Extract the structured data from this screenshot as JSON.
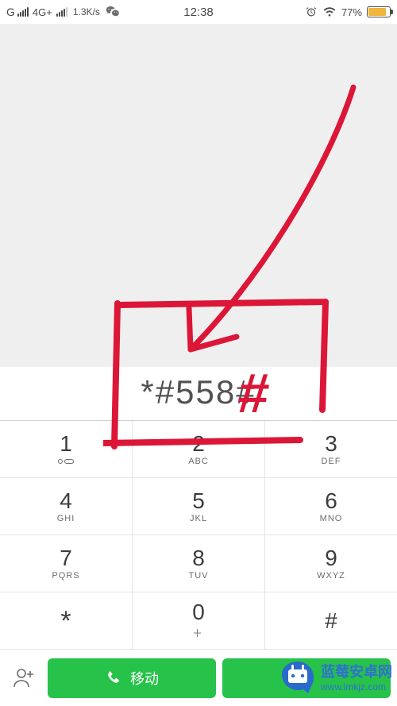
{
  "status": {
    "carrier_indicator": "G",
    "network": "4G+",
    "speed": "1.3K/s",
    "time": "12:38",
    "battery_pct": "77%",
    "wechat_icon": "wechat",
    "alarm_icon": "alarm",
    "wifi_icon": "wifi"
  },
  "dialer": {
    "display": "*#558#",
    "keys": [
      [
        {
          "d": "1",
          "l": "voicemail"
        },
        {
          "d": "2",
          "l": "ABC"
        },
        {
          "d": "3",
          "l": "DEF"
        }
      ],
      [
        {
          "d": "4",
          "l": "GHI"
        },
        {
          "d": "5",
          "l": "JKL"
        },
        {
          "d": "6",
          "l": "MNO"
        }
      ],
      [
        {
          "d": "7",
          "l": "PQRS"
        },
        {
          "d": "8",
          "l": "TUV"
        },
        {
          "d": "9",
          "l": "WXYZ"
        }
      ],
      [
        {
          "d": "*",
          "l": ""
        },
        {
          "d": "0",
          "l": "＋"
        },
        {
          "d": "#",
          "l": ""
        }
      ]
    ],
    "actions": {
      "add_contact_icon": "add-contact",
      "call1_label": "移动",
      "call2_label": ""
    }
  },
  "watermark": {
    "title": "蓝莓安卓网",
    "url": "www.lmkjz.com"
  }
}
